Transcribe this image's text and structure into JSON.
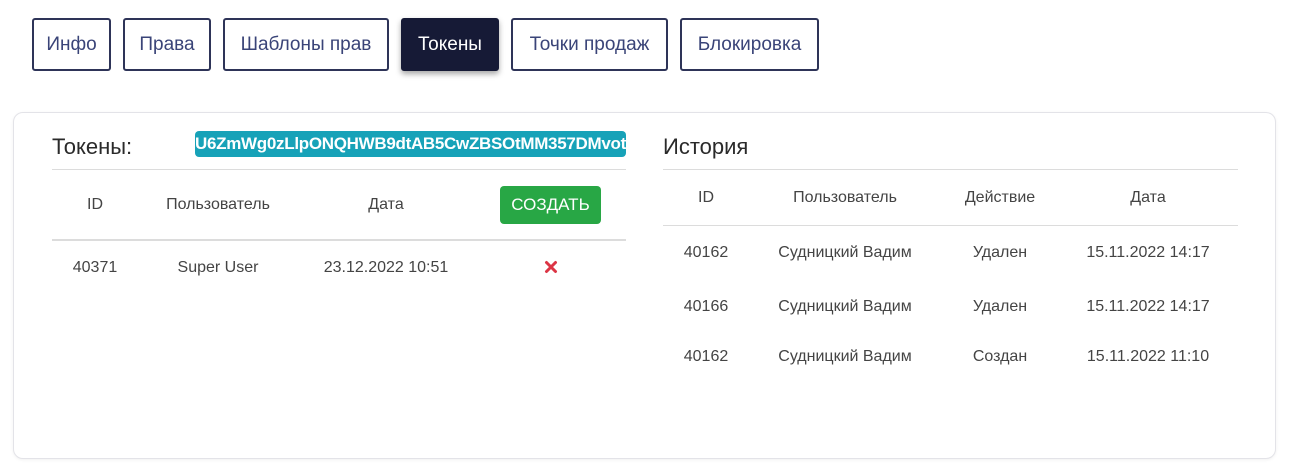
{
  "tabs": [
    {
      "label": "Инфо"
    },
    {
      "label": "Права"
    },
    {
      "label": "Шаблоны прав"
    },
    {
      "label": "Токены"
    },
    {
      "label": "Точки продаж"
    },
    {
      "label": "Блокировка"
    }
  ],
  "active_tab": "Токены",
  "tokens": {
    "title": "Токены:",
    "token_value": "U6ZmWg0zLlpONQHWB9dtAB5CwZBSOtMM357DMvot",
    "columns": {
      "id": "ID",
      "user": "Пользователь",
      "date": "Дата"
    },
    "create_label": "СОЗДАТЬ",
    "rows": [
      {
        "id": "40371",
        "user": "Super User",
        "date": "23.12.2022 10:51"
      }
    ]
  },
  "history": {
    "title": "История",
    "columns": {
      "id": "ID",
      "user": "Пользователь",
      "action": "Действие",
      "date": "Дата"
    },
    "rows": [
      {
        "id": "40162",
        "user": "Судницкий Вадим",
        "action": "Удален",
        "date": "15.11.2022 14:17"
      },
      {
        "id": "40166",
        "user": "Судницкий Вадим",
        "action": "Удален",
        "date": "15.11.2022 14:17"
      },
      {
        "id": "40162",
        "user": "Судницкий Вадим",
        "action": "Создан",
        "date": "15.11.2022 11:10"
      }
    ]
  },
  "colors": {
    "tab_border": "#2e3458",
    "tab_active_bg": "#161a36",
    "token_badge": "#17a2b8",
    "create_button": "#28a745",
    "delete_icon": "#dc3545"
  },
  "icons": {
    "delete": "close-x-icon"
  }
}
